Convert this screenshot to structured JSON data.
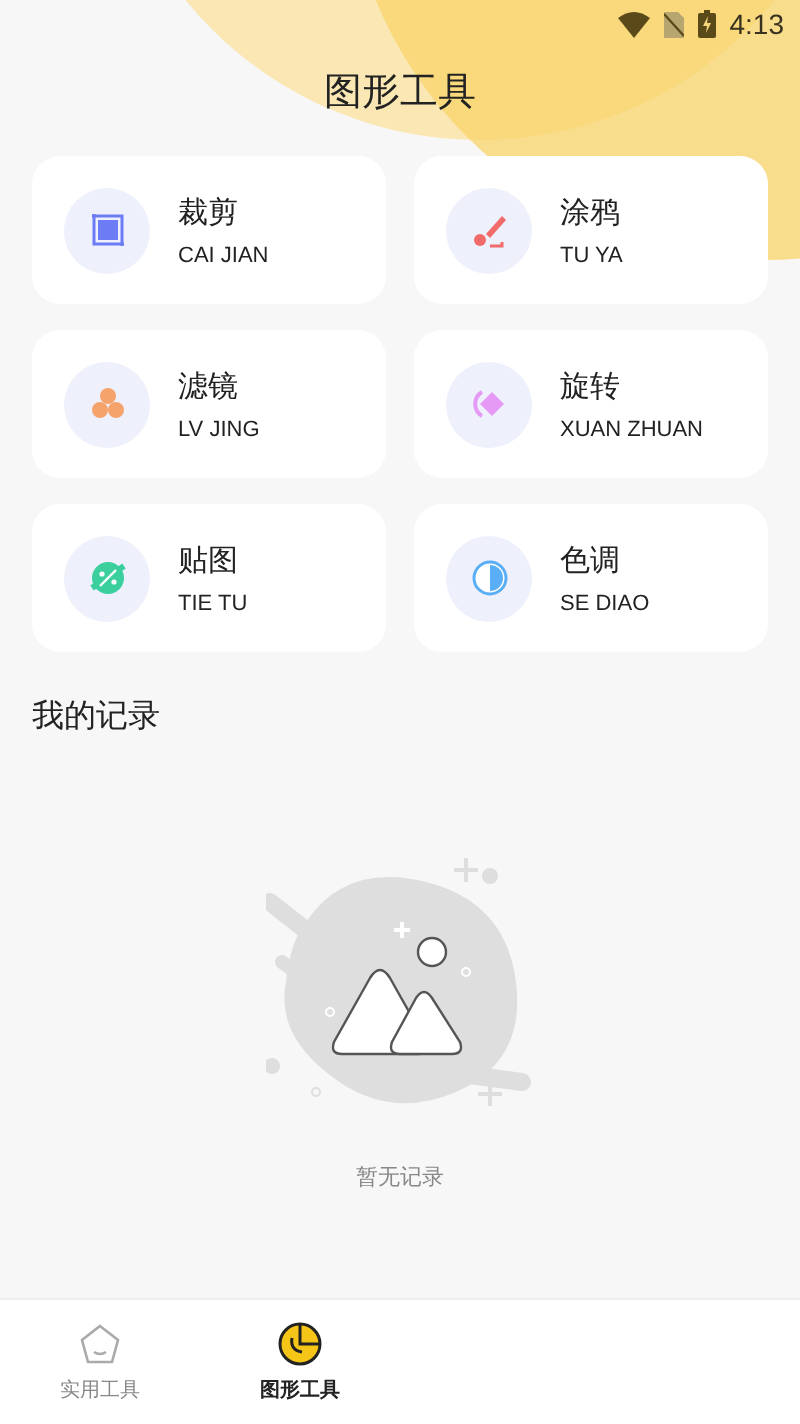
{
  "status_bar": {
    "time": "4:13"
  },
  "title": "图形工具",
  "tools": [
    {
      "name": "裁剪",
      "pinyin": "CAI JIAN",
      "kind": "crop"
    },
    {
      "name": "涂鸦",
      "pinyin": "TU YA",
      "kind": "brush"
    },
    {
      "name": "滤镜",
      "pinyin": "LV JING",
      "kind": "filter"
    },
    {
      "name": "旋转",
      "pinyin": "XUAN ZHUAN",
      "kind": "rotate"
    },
    {
      "name": "贴图",
      "pinyin": "TIE TU",
      "kind": "sticker"
    },
    {
      "name": "色调",
      "pinyin": "SE DIAO",
      "kind": "tone"
    }
  ],
  "records": {
    "title": "我的记录",
    "empty_text": "暂无记录"
  },
  "nav": [
    {
      "label": "实用工具",
      "kind": "home",
      "selected": false
    },
    {
      "label": "图形工具",
      "kind": "chart",
      "selected": true
    }
  ]
}
